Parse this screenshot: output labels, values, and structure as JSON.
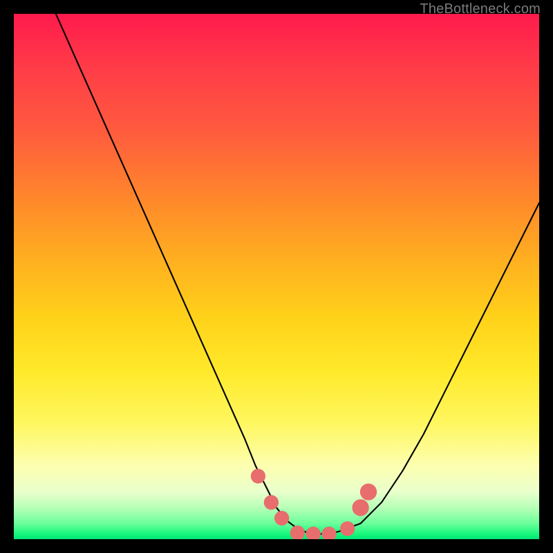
{
  "watermark": {
    "text": "TheBottleneck.com"
  },
  "colors": {
    "background": "#000000",
    "curve": "#000000",
    "marker": "#e86d6d",
    "gradient_top": "#ff1a4c",
    "gradient_bottom": "#00e87a"
  },
  "chart_data": {
    "type": "line",
    "title": "",
    "xlabel": "",
    "ylabel": "",
    "xlim": [
      0,
      100
    ],
    "ylim": [
      0,
      100
    ],
    "grid": false,
    "legend": "none",
    "series": [
      {
        "name": "bottleneck-curve",
        "x": [
          8,
          12,
          16,
          20,
          24,
          28,
          32,
          36,
          40,
          44,
          46,
          48,
          50,
          52,
          54,
          56,
          58,
          60,
          62,
          66,
          70,
          74,
          78,
          82,
          86,
          90,
          94,
          98,
          100
        ],
        "y": [
          100,
          91,
          82,
          73,
          64,
          55,
          46,
          37,
          28,
          19,
          14,
          10,
          6,
          3.5,
          2,
          1.2,
          1,
          1,
          1.5,
          3,
          7,
          13,
          20,
          28,
          36,
          44,
          52,
          60,
          64
        ]
      }
    ],
    "markers": [
      {
        "x": 46.5,
        "y": 12,
        "r": 1.4
      },
      {
        "x": 49,
        "y": 7,
        "r": 1.4
      },
      {
        "x": 51,
        "y": 4,
        "r": 1.4
      },
      {
        "x": 54,
        "y": 1.2,
        "r": 1.4
      },
      {
        "x": 57,
        "y": 1.0,
        "r": 1.4
      },
      {
        "x": 60,
        "y": 1.0,
        "r": 1.4
      },
      {
        "x": 63.5,
        "y": 2,
        "r": 1.4
      },
      {
        "x": 66,
        "y": 6,
        "r": 1.6
      },
      {
        "x": 67.5,
        "y": 9,
        "r": 1.6
      }
    ],
    "annotations": []
  }
}
